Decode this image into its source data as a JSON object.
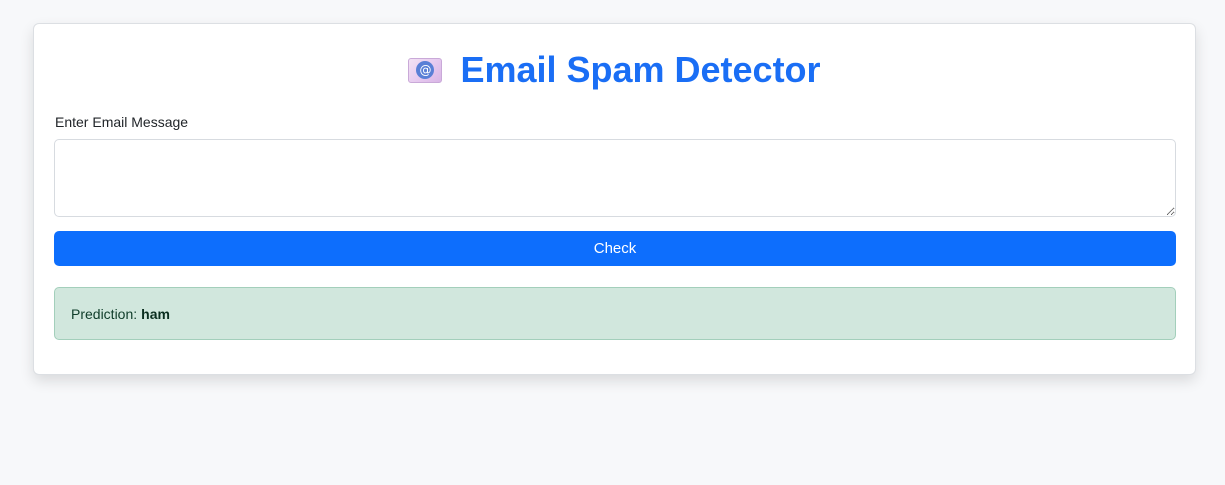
{
  "header": {
    "title": "Email Spam Detector",
    "icon": "email-envelope-icon"
  },
  "form": {
    "label": "Enter Email Message",
    "message_value": "",
    "check_label": "Check"
  },
  "result": {
    "prefix": "Prediction:",
    "value": "ham"
  },
  "colors": {
    "accent": "#0d6efd",
    "title": "#1a6ef5",
    "success_bg": "#d1e7dd"
  }
}
